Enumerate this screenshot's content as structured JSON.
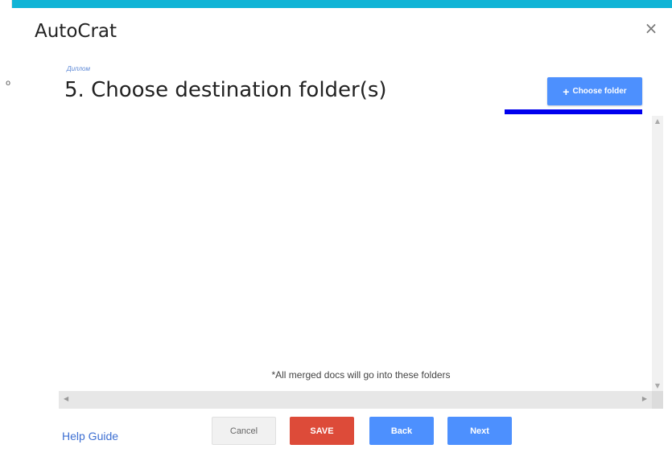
{
  "background": {
    "side_char": "o"
  },
  "dialog": {
    "title": "AutoCrat",
    "close_icon": "×",
    "breadcrumb": "Диплом",
    "step_title": "5. Choose destination folder(s)",
    "choose_folder_button": {
      "icon": "+",
      "label": "Choose folder"
    },
    "note": "*All merged docs will go into these folders",
    "help_link": "Help Guide",
    "buttons": {
      "cancel": "Cancel",
      "save": "SAVE",
      "back": "Back",
      "next": "Next"
    }
  },
  "colors": {
    "page_background": "#10b4d6",
    "primary": "#4d90fe",
    "save": "#dd4b39",
    "highlight_bar": "#0000ee"
  }
}
